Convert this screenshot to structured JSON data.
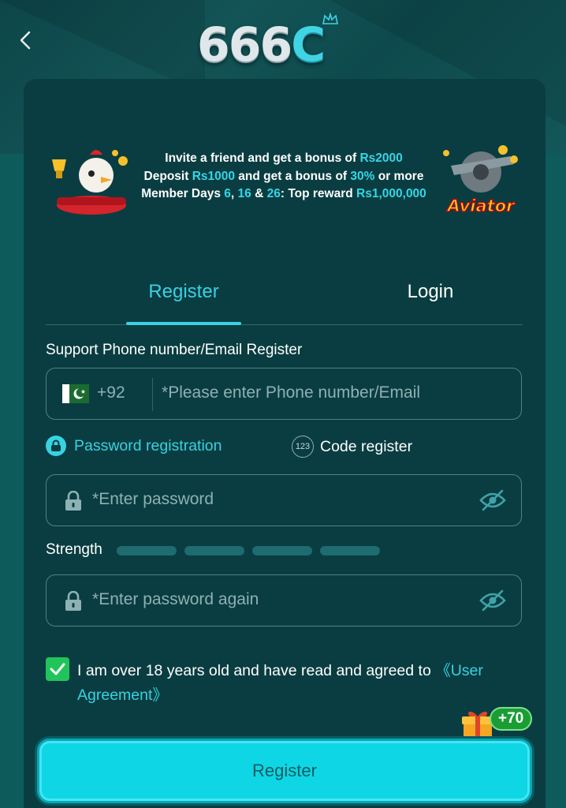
{
  "header": {
    "logo_text": "666",
    "logo_c": "C",
    "icons": {
      "back": "chevron-left-icon"
    }
  },
  "promo": {
    "line1": {
      "pre": "Invite a friend and get a bonus of ",
      "hl": "Rs2000"
    },
    "line2": {
      "pre": "Deposit ",
      "hl1": "Rs1000",
      "mid": " and get a bonus of ",
      "hl2": "30%",
      "post": " or more"
    },
    "line3": {
      "pre": "Member Days ",
      "d1": "6",
      "sep1": ", ",
      "d2": "16",
      "sep2": " & ",
      "d3": "26",
      "mid": ": Top reward ",
      "reward": "Rs1,000,000"
    },
    "right_label": "Aviator"
  },
  "tabs": {
    "register": "Register",
    "login": "Login",
    "active": "register"
  },
  "form": {
    "section_label": "Support Phone number/Email Register",
    "phone": {
      "country_code": "+92",
      "required_mark": "*",
      "placeholder": "Please enter Phone number/Email"
    },
    "modes": {
      "password": "Password registration",
      "code": "Code register",
      "code_icon_text": "123"
    },
    "password": {
      "required_mark": "*",
      "placeholder": "Enter password"
    },
    "strength_label": "Strength",
    "password_again": {
      "required_mark": "*",
      "placeholder": "Enter password again"
    },
    "agreement": {
      "text": "I am over 18 years old and have read and agreed to ",
      "link": "《User Agreement》",
      "checked": true
    },
    "gift_badge": "+70",
    "submit_label": "Register"
  },
  "colors": {
    "accent": "#38d2e3",
    "card_bg": "#0a3d41",
    "button_bg": "#0ed6e5",
    "checkbox": "#21c45a",
    "required": "#e45a4a"
  }
}
